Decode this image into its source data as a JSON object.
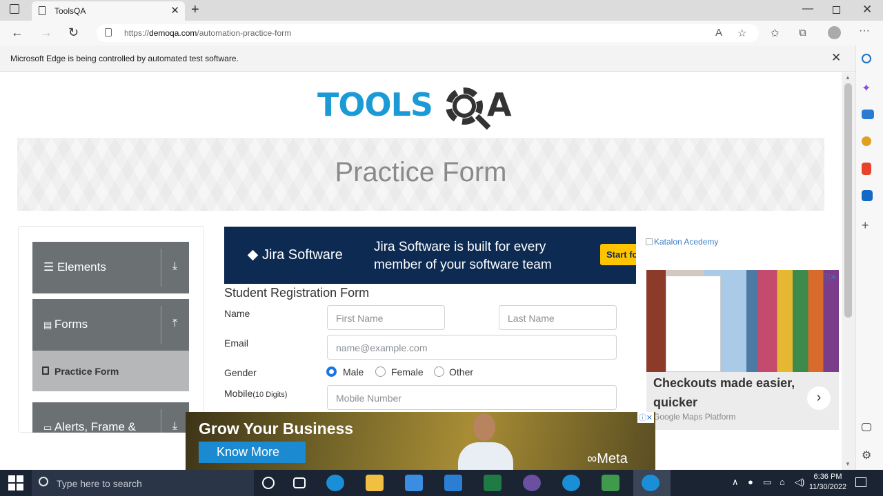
{
  "browser": {
    "tab_title": "ToolsQA",
    "url_prefix": "https://",
    "url_host": "demoqa.com",
    "url_path": "/automation-practice-form",
    "infobar_message": "Microsoft Edge is being controlled by automated test software."
  },
  "site": {
    "logo_left": "TOOLS",
    "logo_right": "A",
    "page_heading": "Practice Form"
  },
  "menu": {
    "groups": [
      {
        "label": "Elements"
      },
      {
        "label": "Forms"
      },
      {
        "label": "Alerts, Frame &"
      }
    ],
    "active_item": "Practice Form"
  },
  "ad_top": {
    "brand": "Jira Software",
    "tagline": "Jira Software is built for every member of your software team",
    "cta": "Start fo"
  },
  "form": {
    "title": "Student Registration Form",
    "name_label": "Name",
    "first_name_placeholder": "First Name",
    "last_name_placeholder": "Last Name",
    "email_label": "Email",
    "email_placeholder": "name@example.com",
    "gender_label": "Gender",
    "gender_options": [
      "Male",
      "Female",
      "Other"
    ],
    "gender_selected": "Male",
    "mobile_label": "Mobile",
    "mobile_hint": "(10 Digits)",
    "mobile_placeholder": "Mobile Number"
  },
  "right_ads": {
    "katalon_alt": "Katalon Acedemy",
    "maps_headline": "Checkouts made easier, quicker",
    "maps_source": "Google Maps Platform"
  },
  "bottom_ad": {
    "headline": "Grow Your Business",
    "cta": "Know More",
    "brand": "Meta"
  },
  "taskbar": {
    "search_placeholder": "Type here to search",
    "time": "6:36 PM",
    "date": "11/30/2022"
  },
  "colors": {
    "brand_blue": "#1c9ad6",
    "menu_gray": "#6b7173",
    "jira_navy": "#0d2b52",
    "radio_blue": "#1a73e8"
  },
  "icons": [
    "tab-actions-icon",
    "new-tab-icon",
    "back-icon",
    "forward-icon",
    "refresh-icon",
    "lock-icon",
    "read-aloud-icon",
    "favorite-add-icon",
    "favorites-icon",
    "collections-icon",
    "profile-icon",
    "more-icon",
    "minimize-icon",
    "maximize-icon",
    "close-window-icon",
    "search-icon",
    "windows-start-icon"
  ]
}
